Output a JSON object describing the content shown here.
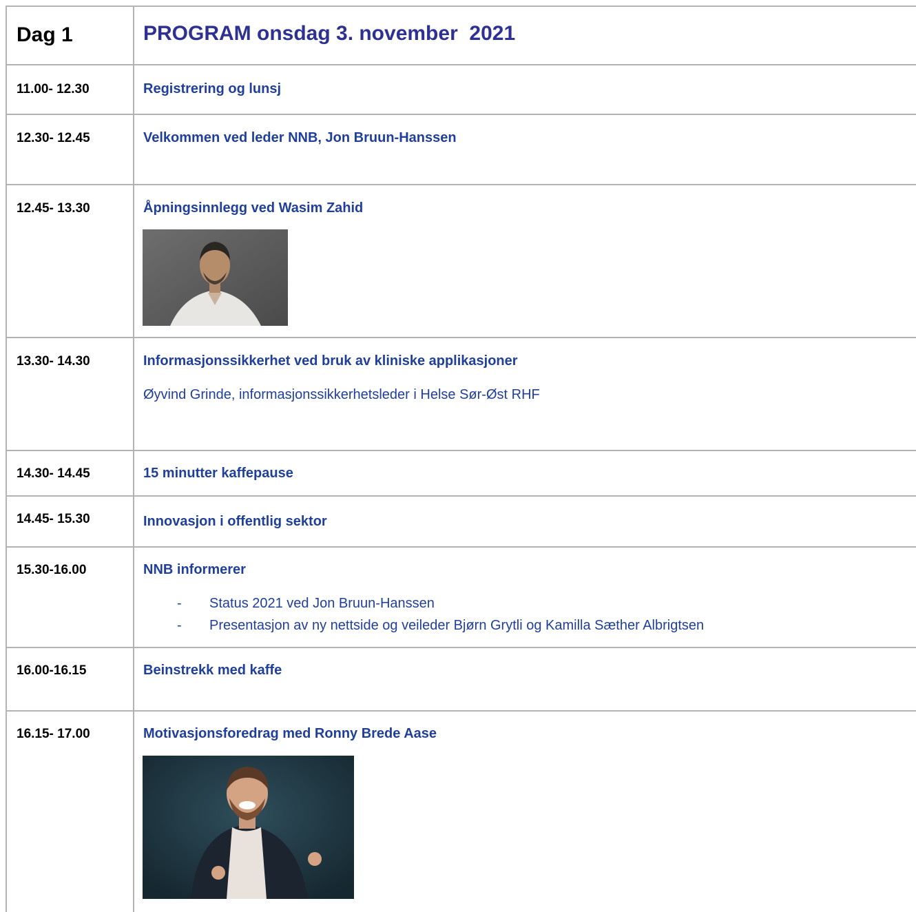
{
  "header": {
    "day": "Dag 1",
    "program_title": "PROGRAM onsdag 3. november  2021"
  },
  "colors": {
    "title_blue": "#1f3f9a",
    "header_blue": "#2e3192",
    "grid": "#b3b3b3"
  },
  "rows": [
    {
      "time": "11.00- 12.30",
      "title": "Registrering og lunsj"
    },
    {
      "time": "12.30- 12.45",
      "title": "Velkommen ved leder NNB, Jon Bruun-Hanssen"
    },
    {
      "time": "12.45- 13.30",
      "title": "Åpningsinnlegg ved Wasim Zahid",
      "photo": "portrait-photo"
    },
    {
      "time": "13.30- 14.30",
      "title": "Informasjonssikkerhet ved bruk av kliniske applikasjoner",
      "subtitle": "Øyvind Grinde, informasjonssikkerhetsleder i Helse Sør-Øst RHF"
    },
    {
      "time": "14.30- 14.45",
      "title": "15 minutter kaffepause"
    },
    {
      "time": "14.45- 15.30",
      "title": "Innovasjon i offentlig sektor"
    },
    {
      "time": "15.30-16.00",
      "title": "NNB informerer",
      "bullets": [
        "Status 2021 ved Jon Bruun-Hanssen",
        "Presentasjon av ny nettside og veileder Bjørn Grytli og Kamilla Sæther Albrigtsen"
      ]
    },
    {
      "time": "16.00-16.15",
      "title": "Beinstrekk med kaffe"
    },
    {
      "time": "16.15- 17.00",
      "title": "Motivasjonsforedrag med Ronny Brede Aase",
      "photo": "portrait-photo"
    }
  ],
  "bullet_marker": "-"
}
